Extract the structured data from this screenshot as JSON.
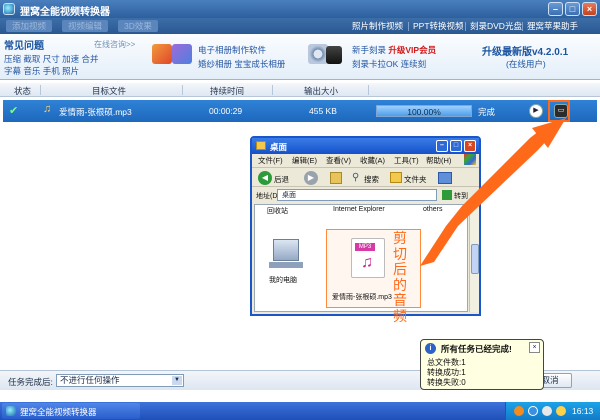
{
  "window": {
    "title": "狸窝全能视频转换器"
  },
  "toolbar": {
    "left_buttons": [
      "添加视频",
      "视频编辑",
      "3D效果"
    ],
    "right_links": [
      "照片制作视频",
      "PPT转换视频",
      "刻录DVD光盘",
      "狸窝苹果助手"
    ]
  },
  "banner": {
    "faq_title": "常见问题",
    "faq_online": "在线咨询>>",
    "faq_line1": "压缩 截取 尺寸 加速 合并",
    "faq_line2": "字幕 音乐 手机 照片",
    "promo1_line1": "电子相册制作软件",
    "promo1_line2": "婚纱相册 宝宝成长相册",
    "promo2_line1_a": "新手刻录",
    "promo2_line1_b": "升级VIP会员",
    "promo2_line2": "刻录卡拉OK 连续刻",
    "upgrade_title": "升级最新版v4.2.0.1",
    "upgrade_sub": "(在线用户)"
  },
  "columns": {
    "status": "状态",
    "target_file": "目标文件",
    "duration": "持续时间",
    "output_size": "输出大小"
  },
  "task": {
    "status_icon": "check-icon",
    "filename": "爱情雨-张根硕.mp3",
    "duration": "00:00:29",
    "size": "455 KB",
    "progress_label": "100.00%",
    "progress": 1.0,
    "state": "完成"
  },
  "explorer": {
    "title": "桌面",
    "menu": [
      "文件(F)",
      "编辑(E)",
      "查看(V)",
      "收藏(A)",
      "工具(T)",
      "帮助(H)"
    ],
    "back_label": "后退",
    "search_label": "搜索",
    "folders_label": "文件夹",
    "address_label": "地址(D)",
    "address_value": "桌面",
    "go_label": "转到",
    "top_items": [
      "回收站",
      "Internet Explorer",
      "others"
    ],
    "my_computer": "我的电脑",
    "mp3_tag": "MP3",
    "mp3_file": "爱情雨-张根硕.mp3",
    "annotation": "剪切后的音频"
  },
  "bottom": {
    "after_label": "任务完成后:",
    "after_value": "不进行任何操作",
    "cancel_label": "取消"
  },
  "balloon": {
    "title": "所有任务已经完成!",
    "total": "总文件数:1",
    "success": "转换成功:1",
    "failed": "转换失败:0"
  },
  "taskbar": {
    "item_label": "狸窝全能视频转换器",
    "clock": "16:13"
  },
  "colors": {
    "accent": "#1d68bd",
    "highlight": "#ff6a1a",
    "vip_red": "#d41a1a"
  }
}
